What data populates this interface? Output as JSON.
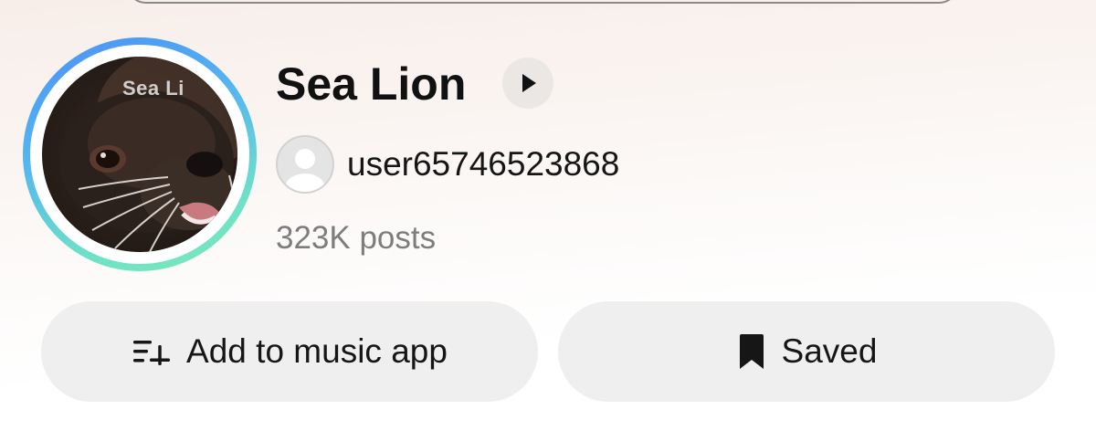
{
  "playlist": {
    "title": "Sea Lion",
    "cover_watermark": "Sea Li",
    "author": "user65746523868",
    "posts_count": "323K posts"
  },
  "actions": {
    "add_music_label": "Add to music app",
    "saved_label": "Saved"
  },
  "icons": {
    "play": "play-icon",
    "add_playlist": "playlist-add-icon",
    "bookmark": "bookmark-icon",
    "default_avatar": "default-avatar-icon"
  },
  "colors": {
    "ring_start": "#4a8ff5",
    "ring_end": "#7deab6",
    "button_bg": "#efefef",
    "title_text": "#111111",
    "secondary_text": "#7d7d7d"
  }
}
